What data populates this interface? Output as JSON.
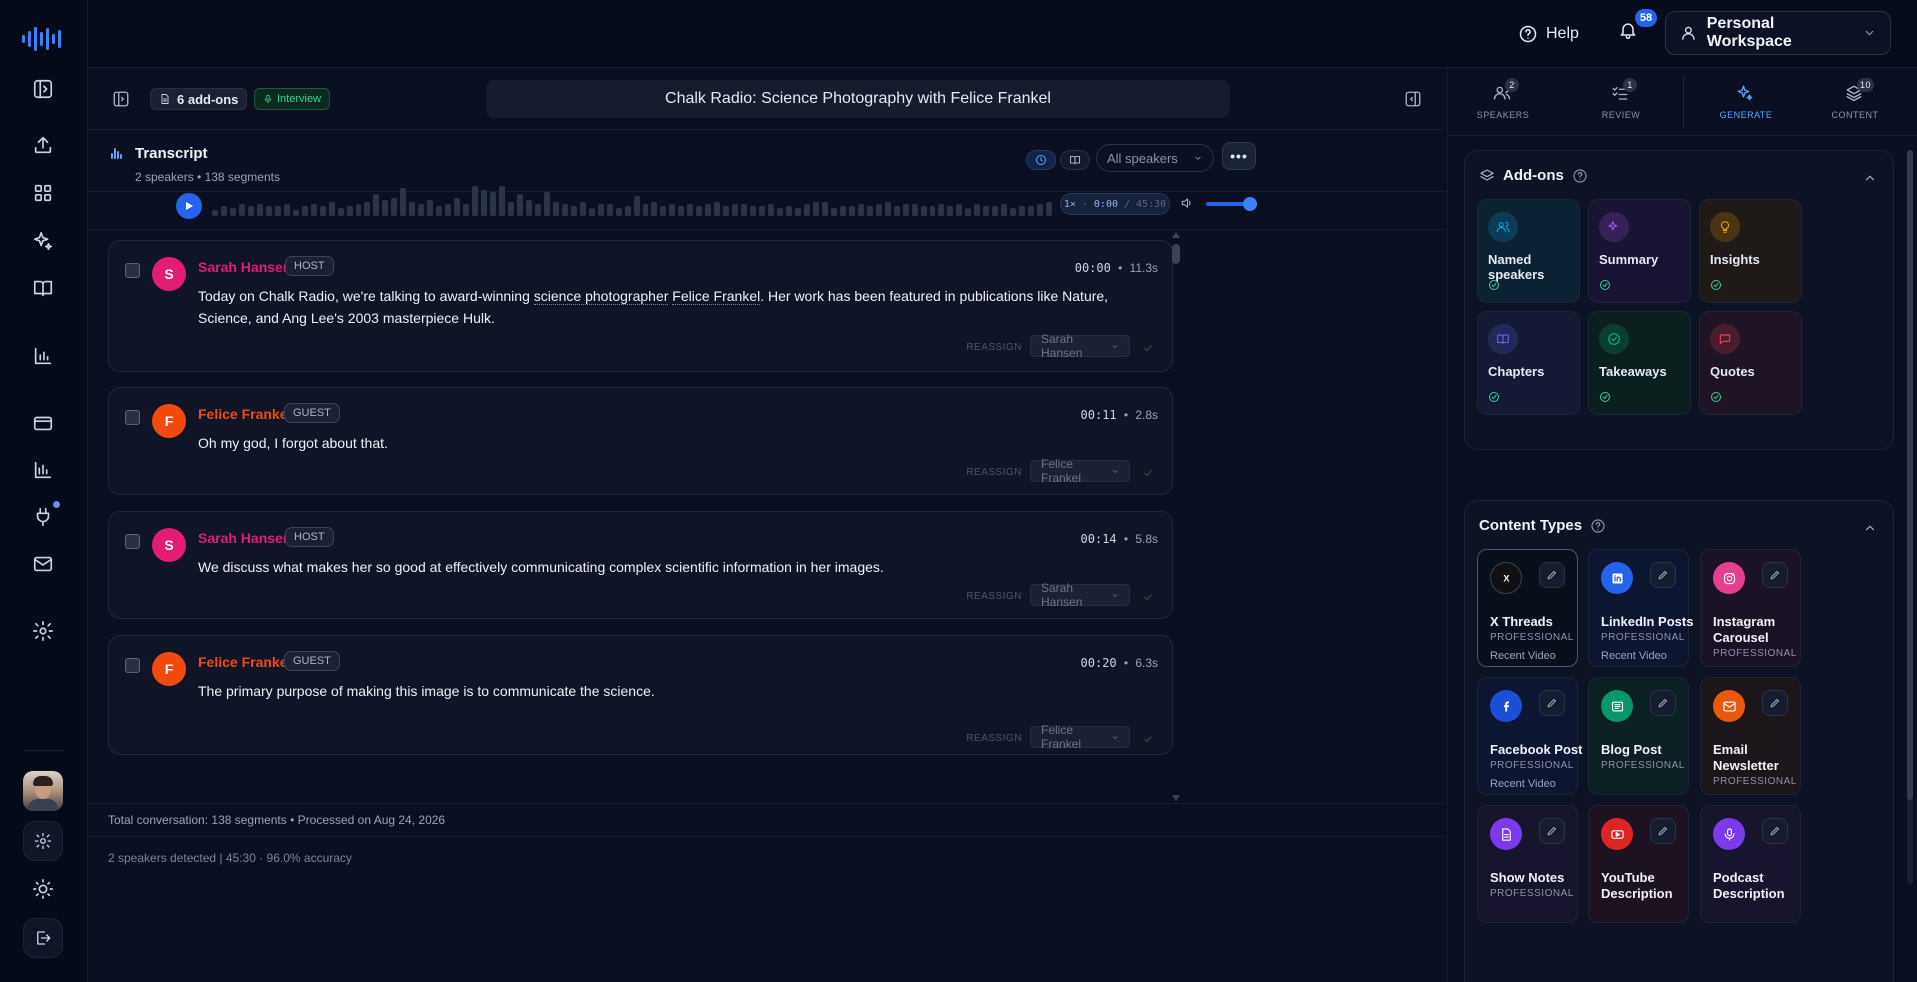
{
  "app": {
    "accent": "#2563eb"
  },
  "topbar": {
    "help_label": "Help",
    "notification_count": "58",
    "workspace_label": "Personal Workspace"
  },
  "header": {
    "addons_label": "6 add-ons",
    "tag_label": "Interview",
    "episode_title": "Chalk Radio: Science Photography with Felice Frankel"
  },
  "transcript": {
    "title": "Transcript",
    "subtitle": "2 speakers • 138 segments",
    "speaker_filter": "All speakers",
    "more_label": "•••",
    "player": {
      "speed": "1×",
      "position": "0:00",
      "duration": "/ 45:30",
      "progress": 0,
      "volume": 1.0
    },
    "reassign_label": "REASSIGN",
    "segments": [
      {
        "initial": "S",
        "speaker": "Sarah Hansen",
        "role": "HOST",
        "time": "00:00",
        "duration": "11.3s",
        "text_before": "Today on Chalk Radio, we're talking to award-winning ",
        "text_link1": "science photographer",
        "text_mid": " ",
        "text_link2": "Felice Frankel",
        "text_after": ". Her work has been featured in publications like Nature, Science, and Ang Lee's 2003 masterpiece Hulk.",
        "reassign_value": "Sarah Hansen",
        "color": "#e11d74"
      },
      {
        "initial": "F",
        "speaker": "Felice Frankel",
        "role": "GUEST",
        "time": "00:11",
        "duration": "2.8s",
        "text": "Oh my god, I forgot about that.",
        "reassign_value": "Felice Frankel",
        "color": "#f24a0c"
      },
      {
        "initial": "S",
        "speaker": "Sarah Hansen",
        "role": "HOST",
        "time": "00:14",
        "duration": "5.8s",
        "text": "We discuss what makes her so good at effectively communicating complex scientific information in her images.",
        "reassign_value": "Sarah Hansen",
        "color": "#e11d74"
      },
      {
        "initial": "F",
        "speaker": "Felice Frankel",
        "role": "GUEST",
        "time": "00:20",
        "duration": "6.3s",
        "text": "The primary purpose of making this image is to communicate the science.",
        "reassign_value": "Felice Frankel",
        "color": "#f24a0c"
      }
    ],
    "footer_total": "Total conversation: 138 segments • Processed on Aug 24, 2026",
    "footer_stats": "2 speakers detected | 45:30 · 96.0% accuracy"
  },
  "right_tabs": [
    {
      "label": "SPEAKERS",
      "count": "2"
    },
    {
      "label": "REVIEW",
      "count": "1"
    },
    {
      "label": "GENERATE",
      "count": ""
    },
    {
      "label": "CONTENT",
      "count": "10"
    }
  ],
  "addons": {
    "title": "Add-ons",
    "items": [
      {
        "label": "Named speakers",
        "icon": "users-icon",
        "color": "#0ea5e9",
        "bg": "#0c2233"
      },
      {
        "label": "Summary",
        "icon": "sparkles-icon",
        "color": "#a855f7",
        "bg": "#1a1433"
      },
      {
        "label": "Insights",
        "icon": "lightbulb-icon",
        "color": "#f59e0b",
        "bg": "#1f1a17"
      },
      {
        "label": "Chapters",
        "icon": "book-icon",
        "color": "#6366f1",
        "bg": "#141a33"
      },
      {
        "label": "Takeaways",
        "icon": "check-circle-icon",
        "color": "#10b981",
        "bg": "#0c1f1f"
      },
      {
        "label": "Quotes",
        "icon": "message-icon",
        "color": "#f43f5e",
        "bg": "#1f1424"
      }
    ]
  },
  "content_types": {
    "title": "Content Types",
    "items": [
      {
        "label": "X Threads",
        "tier": "PROFESSIONAL",
        "note": "Recent Video",
        "icon": "x-icon",
        "color": "#111111",
        "bg": "#0a0f1c"
      },
      {
        "label": "LinkedIn Posts",
        "tier": "PROFESSIONAL",
        "note": "Recent Video",
        "icon": "linkedin-icon",
        "color": "#2563eb",
        "bg": "#0d1630"
      },
      {
        "label": "Instagram Carousel",
        "tier": "PROFESSIONAL",
        "note": "",
        "icon": "instagram-icon",
        "color": "#e4408f",
        "bg": "#1c1226"
      },
      {
        "label": "Facebook Post",
        "tier": "PROFESSIONAL",
        "note": "Recent Video",
        "icon": "facebook-icon",
        "color": "#1d4ed8",
        "bg": "#0d1630"
      },
      {
        "label": "Blog Post",
        "tier": "PROFESSIONAL",
        "note": "",
        "icon": "newspaper-icon",
        "color": "#059669",
        "bg": "#0c1f22"
      },
      {
        "label": "Email Newsletter",
        "tier": "PROFESSIONAL",
        "note": "",
        "icon": "mail-icon",
        "color": "#ea580c",
        "bg": "#1c1519"
      },
      {
        "label": "Show Notes",
        "tier": "PROFESSIONAL",
        "note": "",
        "icon": "file-text-icon",
        "color": "#7c3aed",
        "bg": "#17142e"
      },
      {
        "label": "YouTube Description",
        "tier": "",
        "note": "",
        "icon": "youtube-icon",
        "color": "#dc2626",
        "bg": "#1c1220"
      },
      {
        "label": "Podcast Description",
        "tier": "",
        "note": "",
        "icon": "mic-icon",
        "color": "#7c3aed",
        "bg": "#17142e"
      }
    ]
  }
}
